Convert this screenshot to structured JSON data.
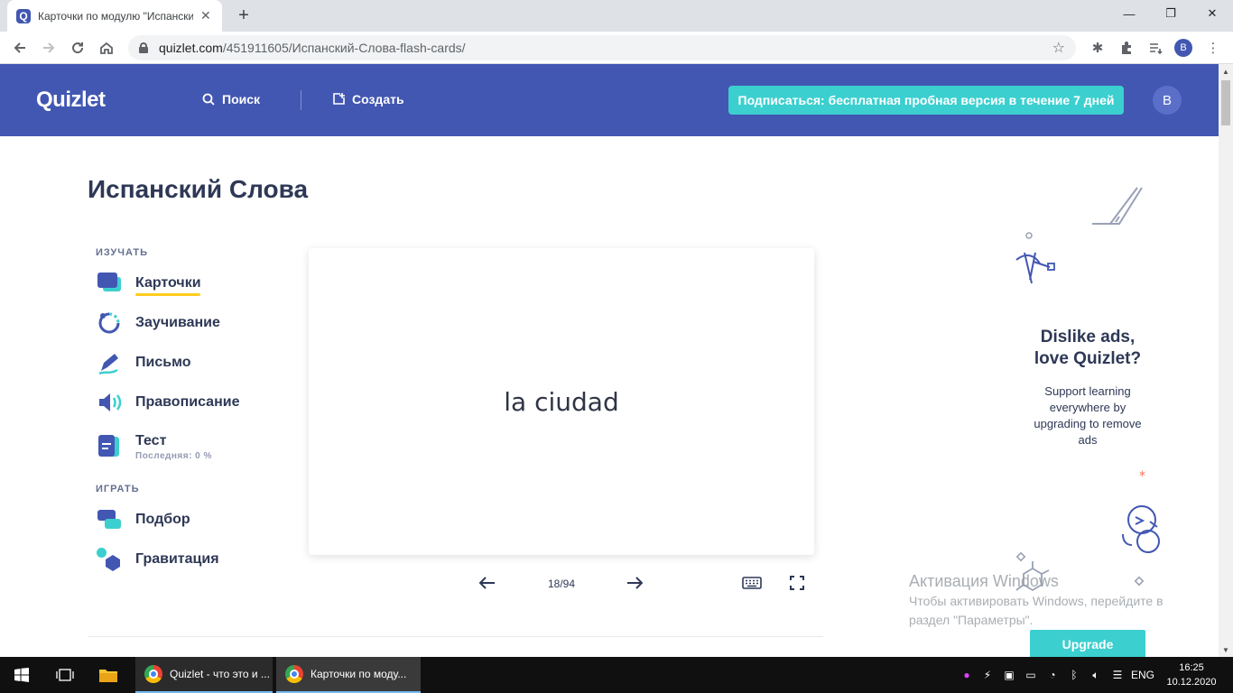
{
  "browser": {
    "tab_title": "Карточки по модулю \"Испанский Слова\"",
    "favicon_letter": "Q",
    "url_host": "quizlet.com",
    "url_path": "/451911605/Испанский-Слова-flash-cards/",
    "profile_letter": "B"
  },
  "header": {
    "logo": "Quizlet",
    "search_label": "Поиск",
    "create_label": "Создать",
    "cta_label": "Подписаться: бесплатная пробная версия в течение 7 дней",
    "avatar_letter": "B",
    "brand_color": "#4257b2",
    "cta_color": "#3ccfcf"
  },
  "page": {
    "title": "Испанский Слова",
    "study_section": "ИЗУЧАТЬ",
    "play_section": "ИГРАТЬ",
    "modes": {
      "cards": "Карточки",
      "learn": "Заучивание",
      "write": "Письмо",
      "spell": "Правописание",
      "test": "Тест",
      "test_last": "Последняя: 0 %",
      "match": "Подбор",
      "gravity": "Гравитация"
    }
  },
  "card": {
    "term": "la ciudad",
    "counter": "18/94"
  },
  "ad": {
    "title_line1": "Dislike ads,",
    "title_line2": "love Quizlet?",
    "text": "Support learning everywhere by upgrading to remove ads",
    "upgrade_label": "Upgrade"
  },
  "watermark": {
    "title": "Активация Windows",
    "text": "Чтобы активировать Windows, перейдите в раздел \"Параметры\"."
  },
  "taskbar": {
    "app1_label": "Quizlet - что это и ...",
    "app2_label": "Карточки по моду...",
    "lang": "ENG",
    "time": "16:25",
    "date": "10.12.2020"
  }
}
